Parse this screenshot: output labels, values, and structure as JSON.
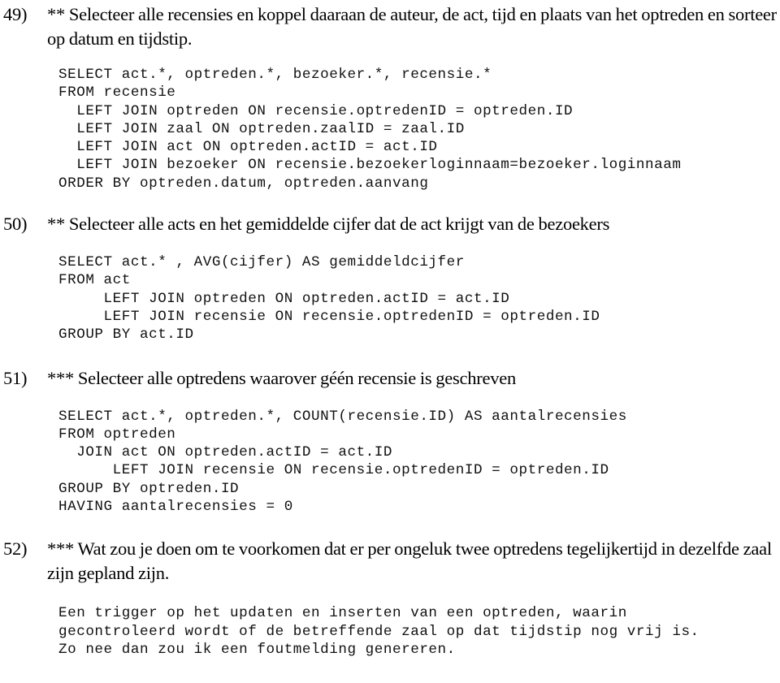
{
  "document": {
    "type": "exercise-sheet",
    "language": "nl",
    "background_color": "#ffffff",
    "text_color": "#000000"
  },
  "questions": [
    {
      "number": "49)",
      "difficulty": "**",
      "prompt": "Selecteer alle recensies en koppel daaraan de auteur, de act, tijd en plaats van het optreden en sorteer op datum en tijdstip.",
      "answer_code": "SELECT act.*, optreden.*, bezoeker.*, recensie.*\nFROM recensie\n  LEFT JOIN optreden ON recensie.optredenID = optreden.ID\n  LEFT JOIN zaal ON optreden.zaalID = zaal.ID\n  LEFT JOIN act ON optreden.actID = act.ID\n  LEFT JOIN bezoeker ON recensie.bezoekerloginnaam=bezoeker.loginnaam\nORDER BY optreden.datum, optreden.aanvang"
    },
    {
      "number": "50)",
      "difficulty": "**",
      "prompt": "Selecteer alle acts en het gemiddelde cijfer dat de act krijgt van de bezoekers",
      "answer_code": "SELECT act.* , AVG(cijfer) AS gemiddeldcijfer\nFROM act\n     LEFT JOIN optreden ON optreden.actID = act.ID\n     LEFT JOIN recensie ON recensie.optredenID = optreden.ID\nGROUP BY act.ID"
    },
    {
      "number": "51)",
      "difficulty": "***",
      "prompt": "Selecteer alle optredens waarover géén recensie is geschreven",
      "answer_code": "SELECT act.*, optreden.*, COUNT(recensie.ID) AS aantalrecensies\nFROM optreden\n  JOIN act ON optreden.actID = act.ID\n      LEFT JOIN recensie ON recensie.optredenID = optreden.ID\nGROUP BY optreden.ID\nHAVING aantalrecensies = 0"
    },
    {
      "number": "52)",
      "difficulty": "***",
      "prompt": "Wat zou je doen om te voorkomen dat er per ongeluk twee optredens tegelijkertijd in dezelfde zaal zijn gepland zijn.",
      "answer_code": "Een trigger op het updaten en inserten van een optreden, waarin\ngecontroleerd wordt of de betreffende zaal op dat tijdstip nog vrij is.\nZo nee dan zou ik een foutmelding genereren."
    }
  ]
}
